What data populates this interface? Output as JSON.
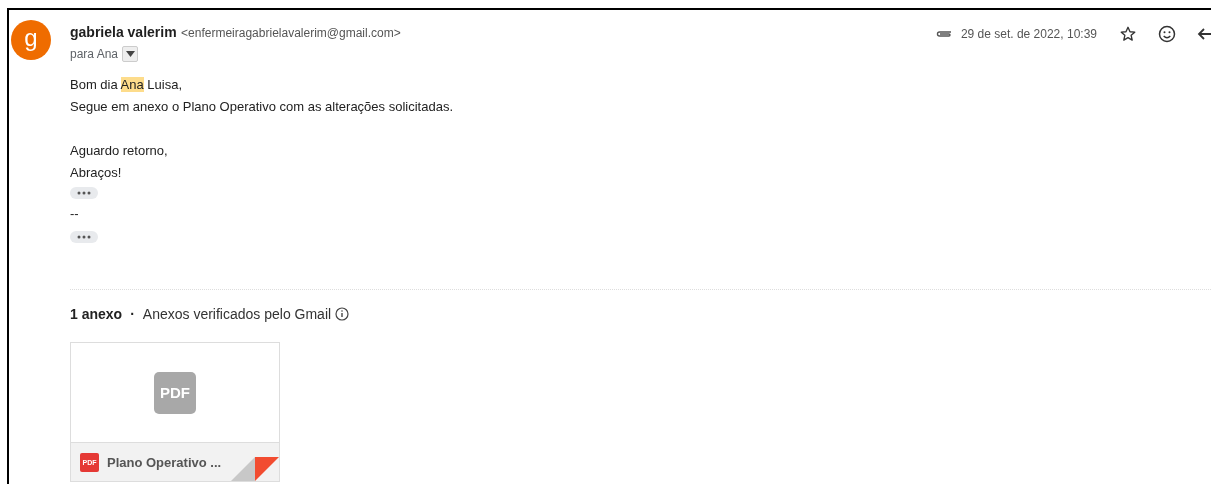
{
  "sender": {
    "avatar_letter": "g",
    "name": "gabriela valerim",
    "email": "<enfermeiragabrielavalerim@gmail.com>",
    "recipient": "para Ana"
  },
  "meta": {
    "date": "29 de set. de 2022, 10:39",
    "has_attachment": true,
    "starred": false
  },
  "body": {
    "greeting_before": "Bom dia ",
    "greeting_highlight": "Ana",
    "greeting_after": " Luisa,",
    "lines": [
      "Segue em anexo o Plano Operativo com as alterações solicitadas."
    ],
    "closing": [
      "Aguardo retorno,",
      "Abraços!"
    ],
    "signature": "--"
  },
  "attachments_header": {
    "count": "1 anexo",
    "separator": "·",
    "note": "Anexos verificados pelo Gmail"
  },
  "attachments": [
    {
      "kind": "pdf",
      "badge": "PDF",
      "thumb_label": "PDF",
      "name": "Plano Operativo ..."
    }
  ]
}
